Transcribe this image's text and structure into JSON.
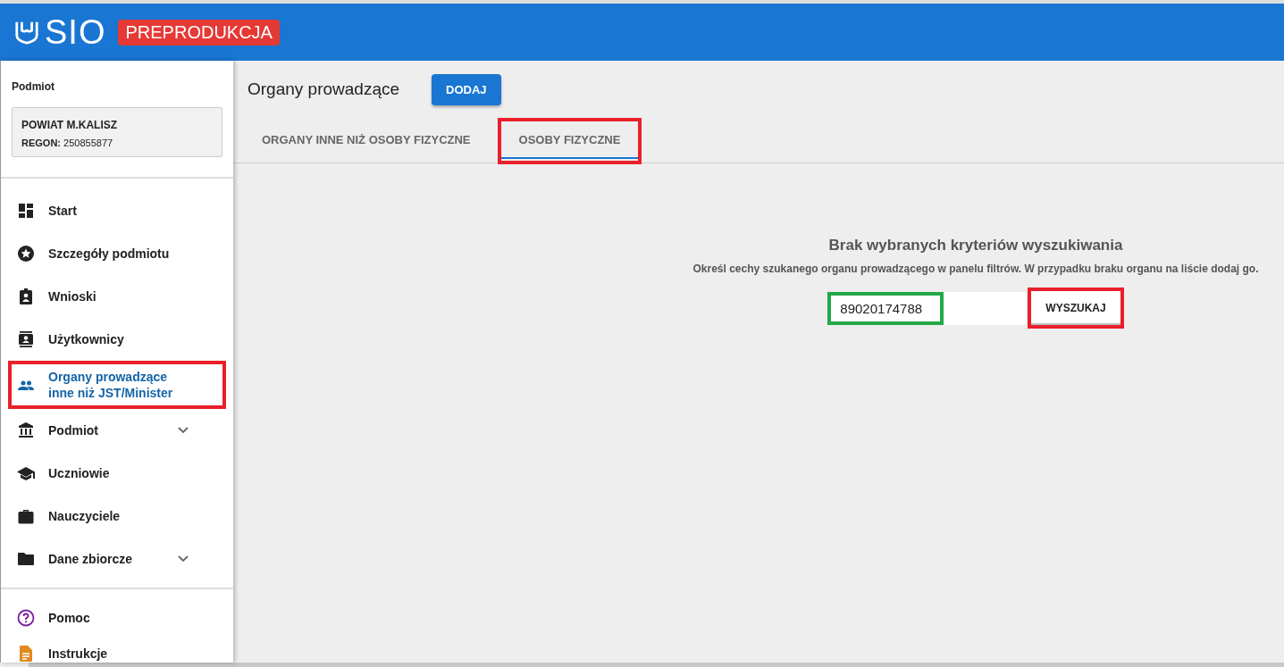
{
  "header": {
    "logo": "SIO",
    "badge": "PREPRODUKCJA"
  },
  "sidebar": {
    "entity_label": "Podmiot",
    "entity": {
      "name": "POWIAT M.KALISZ",
      "regon_label": "REGON:",
      "regon": "250855877"
    },
    "items": [
      {
        "label": "Start",
        "selected": false,
        "expandable": false,
        "highlighted": false
      },
      {
        "label": "Szczegóły podmiotu",
        "selected": false,
        "expandable": false,
        "highlighted": false
      },
      {
        "label": "Wnioski",
        "selected": false,
        "expandable": false,
        "highlighted": false
      },
      {
        "label": "Użytkownicy",
        "selected": false,
        "expandable": false,
        "highlighted": false
      },
      {
        "label": "Organy prowadzące inne niż JST/Minister",
        "selected": true,
        "expandable": false,
        "highlighted": true
      },
      {
        "label": "Podmiot",
        "selected": false,
        "expandable": true,
        "highlighted": false
      },
      {
        "label": "Uczniowie",
        "selected": false,
        "expandable": false,
        "highlighted": false
      },
      {
        "label": "Nauczyciele",
        "selected": false,
        "expandable": false,
        "highlighted": false
      },
      {
        "label": "Dane zbiorcze",
        "selected": false,
        "expandable": true,
        "highlighted": false
      }
    ],
    "footer_items": [
      {
        "label": "Pomoc"
      },
      {
        "label": "Instrukcje"
      }
    ]
  },
  "page": {
    "title": "Organy prowadzące",
    "add_button": "DODAJ",
    "tabs": [
      {
        "label": "ORGANY INNE NIŻ OSOBY FIZYCZNE",
        "selected": false,
        "highlighted": false
      },
      {
        "label": "OSOBY FIZYCZNE",
        "selected": true,
        "highlighted": true
      }
    ],
    "empty_title": "Brak wybranych kryteriów wyszukiwania",
    "empty_text": "Określ cechy szukanego organu prowadzącego w panelu filtrów. W przypadku braku organu na liście dodaj go.",
    "search": {
      "value": "89020174788",
      "highlighted": true
    },
    "search_button": {
      "label": "WYSZUKAJ",
      "highlighted": true
    }
  }
}
